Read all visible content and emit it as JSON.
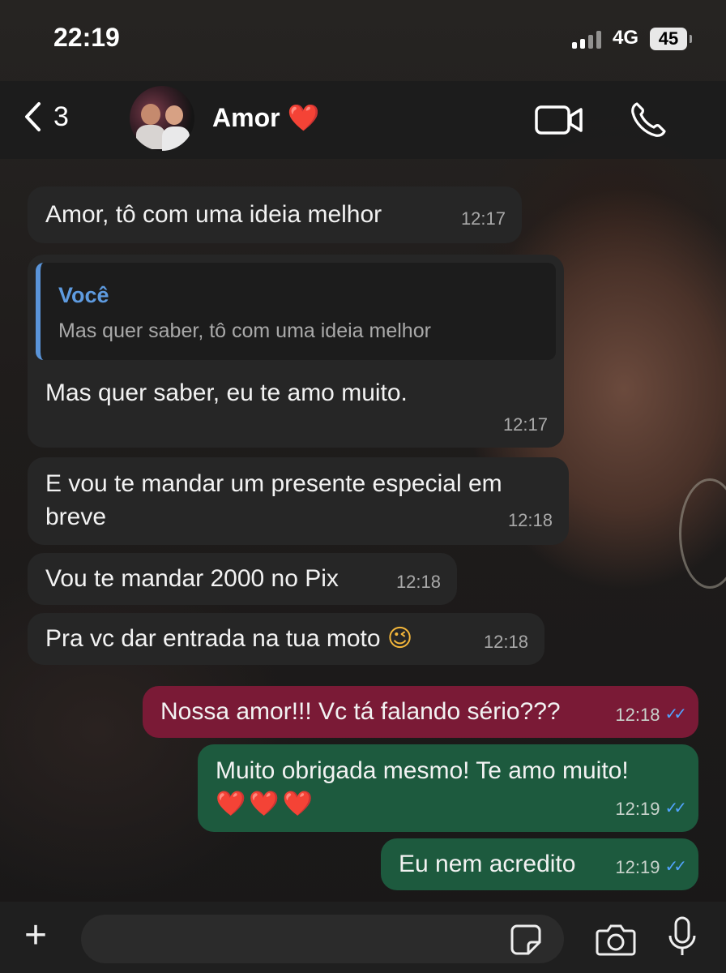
{
  "status": {
    "time": "22:19",
    "network": "4G",
    "battery": "45"
  },
  "header": {
    "back_count": "3",
    "contact_name": "Amor",
    "contact_emoji": "❤️"
  },
  "messages": [
    {
      "direction": "in",
      "text": "Amor, tô com uma ideia melhor",
      "time": "12:17"
    },
    {
      "direction": "in",
      "quote_author": "Você",
      "quote_text": "Mas quer saber, tô com uma ideia melhor",
      "text": "Mas quer saber, eu te amo muito.",
      "time": "12:17"
    },
    {
      "direction": "in",
      "text_line1": "E vou te mandar um presente especial em",
      "text_line2": "breve",
      "time": "12:18"
    },
    {
      "direction": "in",
      "text": "Vou te mandar 2000 no Pix",
      "time": "12:18"
    },
    {
      "direction": "in",
      "text": "Pra vc dar entrada na tua moto",
      "emoji": "😉",
      "time": "12:18"
    },
    {
      "direction": "out",
      "text": "Nossa amor!!! Vc tá falando sério???",
      "time": "12:18",
      "ticks": "✓✓"
    },
    {
      "direction": "out",
      "text": "Muito obrigada mesmo! Te amo muito!",
      "emoji": "❤️❤️❤️",
      "time": "12:19",
      "ticks": "✓✓"
    },
    {
      "direction": "out",
      "text": "Eu nem acredito",
      "time": "12:19",
      "ticks": "✓✓"
    }
  ],
  "composer": {
    "plus": "+"
  },
  "colors": {
    "incoming": "#262626",
    "outgoing_red": "#7a1a36",
    "outgoing_green": "#1d5a3e",
    "read_ticks": "#52a4ff",
    "quote_accent": "#5a94d9"
  }
}
